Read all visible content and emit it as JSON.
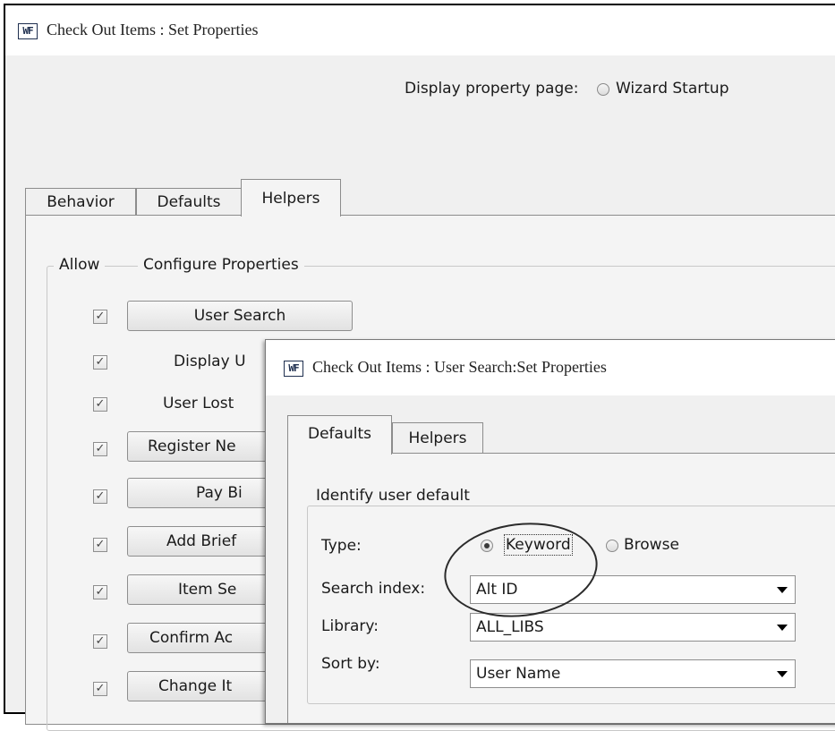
{
  "window": {
    "icon_label": "WF",
    "title": "Check Out Items : Set Properties",
    "display_property_page_label": "Display property page:",
    "display_option": "Wizard Startup"
  },
  "tabs": [
    {
      "label": "Behavior"
    },
    {
      "label": "Defaults"
    },
    {
      "label": "Helpers"
    }
  ],
  "helpers": {
    "allow_header": "Allow",
    "configure_header": "Configure Properties",
    "rows": [
      {
        "label": "User Search",
        "checked": "✓"
      },
      {
        "label": "Display U",
        "checked": "✓"
      },
      {
        "label": "User Lost",
        "checked": "✓"
      },
      {
        "label": "Register Ne",
        "checked": "✓"
      },
      {
        "label": "Pay Bi",
        "checked": "✓"
      },
      {
        "label": "Add Brief",
        "checked": "✓"
      },
      {
        "label": "Item Se",
        "checked": "✓"
      },
      {
        "label": "Confirm Ac",
        "checked": "✓"
      },
      {
        "label": "Change It",
        "checked": "✓"
      }
    ]
  },
  "dialog": {
    "icon_label": "WF",
    "title": "Check Out Items : User Search:Set Properties",
    "tabs": [
      {
        "label": "Defaults"
      },
      {
        "label": "Helpers"
      }
    ],
    "group_title": "Identify user default",
    "type_label": "Type:",
    "type_options": [
      {
        "label": "Keyword",
        "selected": true
      },
      {
        "label": "Browse",
        "selected": false
      }
    ],
    "search_index_label": "Search index:",
    "search_index_value": "Alt ID",
    "library_label": "Library:",
    "library_value": "ALL_LIBS",
    "sort_by_label": "Sort by:",
    "sort_by_value": "User Name"
  }
}
